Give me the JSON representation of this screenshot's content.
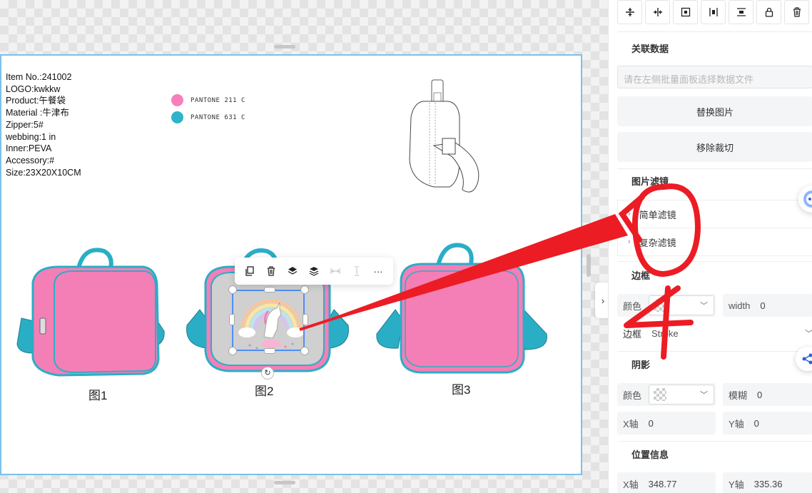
{
  "canvas": {
    "specs": [
      "Item No.:241002",
      "LOGO:kwkkw",
      "Product:午餐袋",
      "Material :牛津布",
      "Zipper:5#",
      "webbing:1 in",
      "Inner:PEVA",
      "Accessory:#",
      "Size:23X20X10CM"
    ],
    "swatches": [
      {
        "name": "PANTONE 211 C",
        "color": "#f77fba"
      },
      {
        "name": "PANTONE 631 C",
        "color": "#2fb3c9"
      }
    ],
    "figure_labels": [
      "图1",
      "图2",
      "图3"
    ],
    "colors": {
      "bag_pink": "#f47fb6",
      "bag_teal": "#2aaec6",
      "bag_grey": "#cfd0cf",
      "selection": "#4f8ff7",
      "annotation_red": "#ec1c24"
    }
  },
  "floating_toolbar": {
    "icons": [
      "copy-icon",
      "delete-icon",
      "layer-up-icon",
      "layer-top-icon",
      "distribute-horizontal-icon",
      "distribute-vertical-icon",
      "more-icon"
    ],
    "more_label": "···"
  },
  "panel": {
    "align_icons": [
      "align-vertical-center-icon",
      "align-horizontal-center-icon",
      "fit-canvas-icon",
      "distribute-horizontal-icon",
      "distribute-vertical-icon",
      "lock-icon",
      "trash-icon"
    ],
    "linked_data": {
      "title": "关联数据",
      "placeholder": "请在左侧批量面板选择数据文件"
    },
    "replace_image": "替换图片",
    "remove_crop": "移除裁切",
    "image_filter": {
      "title": "图片滤镜",
      "items": [
        "简单滤镜",
        "复杂滤镜"
      ]
    },
    "border": {
      "title": "边框",
      "color_label": "颜色",
      "width_label": "width",
      "width_value": "0",
      "style_label": "边框",
      "style_value": "Stroke"
    },
    "shadow": {
      "title": "阴影",
      "color_label": "颜色",
      "blur_label": "模糊",
      "blur_value": "0",
      "x_label": "X轴",
      "x_value": "0",
      "y_label": "Y轴",
      "y_value": "0"
    },
    "position": {
      "title": "位置信息",
      "x_label": "X轴",
      "x_value": "348.77",
      "y_label": "Y轴",
      "y_value": "335.36"
    }
  },
  "annotation": {
    "handwritten_text": "0 4"
  }
}
